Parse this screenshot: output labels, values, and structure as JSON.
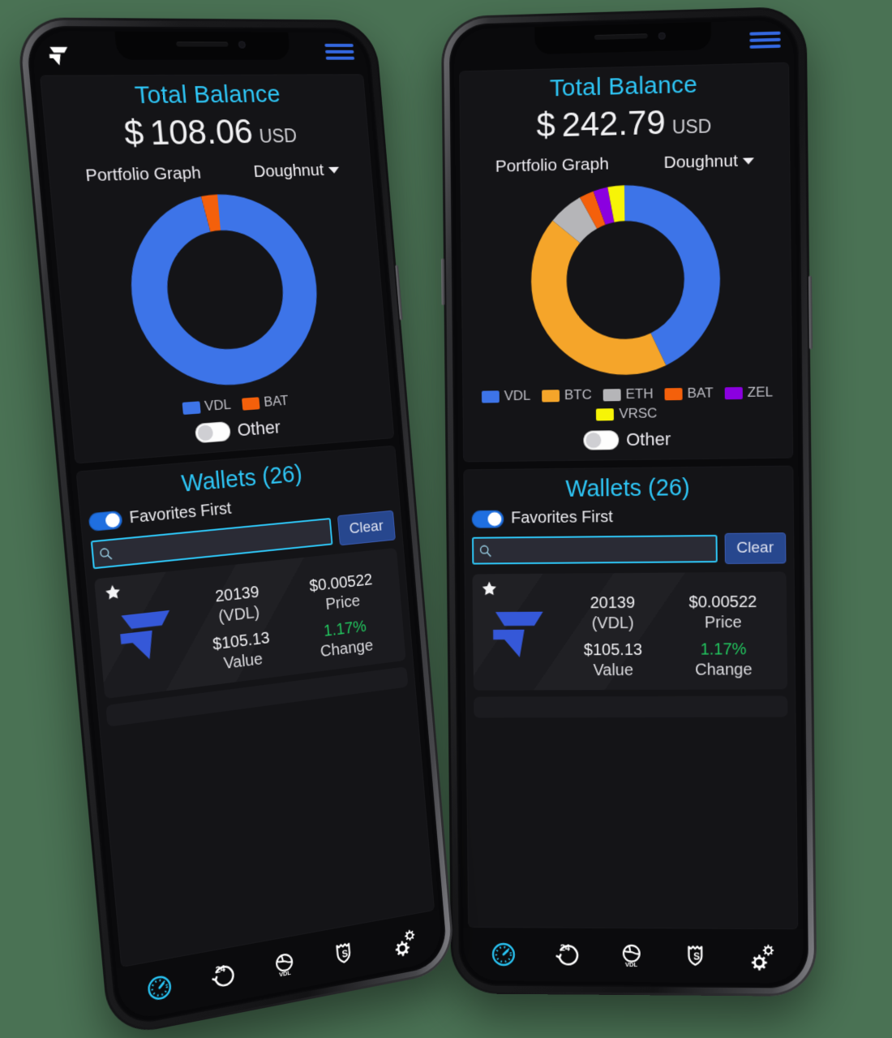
{
  "background_color": "#4a7254",
  "accent": {
    "cyan": "#2ec5f5",
    "blue": "#3468e0",
    "green": "#22c55e",
    "button_blue": "#27478e"
  },
  "phones": [
    {
      "id": "left",
      "brand_logo": "vdl-logo-icon",
      "menu_icon": "hamburger-menu-icon",
      "balance": {
        "title": "Total Balance",
        "currency_symbol": "$",
        "amount": "108.06",
        "currency_code": "USD"
      },
      "graph_controls": {
        "label": "Portfolio Graph",
        "chart_type": "Doughnut",
        "caret_icon": "chevron-down-icon"
      },
      "legend": [
        {
          "label": "VDL",
          "color": "#3d74e8"
        },
        {
          "label": "BAT",
          "color": "#f4600b"
        }
      ],
      "other_toggle": {
        "label": "Other",
        "on": false
      },
      "wallets": {
        "title": "Wallets (26)",
        "favorites_toggle": {
          "label": "Favorites First",
          "on": true
        },
        "search": {
          "value": "",
          "placeholder": "",
          "icon": "search-icon"
        },
        "clear_label": "Clear",
        "items": [
          {
            "favorite": true,
            "coin_logo": "vdl-coin-icon",
            "amount": "20139",
            "ticker": "(VDL)",
            "value": "$105.13",
            "value_label": "Value",
            "price": "$0.00522",
            "price_label": "Price",
            "change": "1.17%",
            "change_label": "Change"
          }
        ]
      },
      "nav": [
        {
          "icon": "dashboard-gauge-icon",
          "active": true
        },
        {
          "icon": "24h-history-icon",
          "active": false
        },
        {
          "icon": "globe-vdl-icon",
          "active": false
        },
        {
          "icon": "shield-dollar-icon",
          "active": false
        },
        {
          "icon": "settings-gears-icon",
          "active": false
        }
      ]
    },
    {
      "id": "right",
      "menu_icon": "hamburger-menu-icon",
      "balance": {
        "title": "Total Balance",
        "currency_symbol": "$",
        "amount": "242.79",
        "currency_code": "USD"
      },
      "graph_controls": {
        "label": "Portfolio Graph",
        "chart_type": "Doughnut",
        "caret_icon": "chevron-down-icon"
      },
      "legend": [
        {
          "label": "VDL",
          "color": "#3d74e8"
        },
        {
          "label": "BTC",
          "color": "#f5a52a"
        },
        {
          "label": "ETH",
          "color": "#b5b5b8"
        },
        {
          "label": "BAT",
          "color": "#f4600b"
        },
        {
          "label": "ZEL",
          "color": "#8b00e0"
        },
        {
          "label": "VRSC",
          "color": "#f7f407"
        }
      ],
      "other_toggle": {
        "label": "Other",
        "on": false
      },
      "wallets": {
        "title": "Wallets (26)",
        "favorites_toggle": {
          "label": "Favorites First",
          "on": true
        },
        "search": {
          "value": "",
          "placeholder": "",
          "icon": "search-icon"
        },
        "clear_label": "Clear",
        "items": [
          {
            "favorite": true,
            "coin_logo": "vdl-coin-icon",
            "amount": "20139",
            "ticker": "(VDL)",
            "value": "$105.13",
            "value_label": "Value",
            "price": "$0.00522",
            "price_label": "Price",
            "change": "1.17%",
            "change_label": "Change"
          }
        ]
      },
      "nav": [
        {
          "icon": "dashboard-gauge-icon",
          "active": true
        },
        {
          "icon": "24h-history-icon",
          "active": false
        },
        {
          "icon": "globe-vdl-icon",
          "active": false
        },
        {
          "icon": "shield-dollar-icon",
          "active": false
        },
        {
          "icon": "settings-gears-icon",
          "active": false
        }
      ]
    }
  ],
  "chart_data": [
    {
      "type": "pie",
      "title": "Portfolio Graph",
      "subtitle": "Doughnut",
      "device": "left",
      "categories": [
        "VDL",
        "BAT"
      ],
      "values": [
        97,
        3
      ],
      "colors": [
        "#3d74e8",
        "#f4600b"
      ],
      "legend_position": "bottom",
      "units": "percent of total balance"
    },
    {
      "type": "pie",
      "title": "Portfolio Graph",
      "subtitle": "Doughnut",
      "device": "right",
      "categories": [
        "VDL",
        "BTC",
        "ETH",
        "BAT",
        "ZEL",
        "VRSC"
      ],
      "values": [
        43,
        43,
        6,
        2.5,
        2.5,
        3
      ],
      "colors": [
        "#3d74e8",
        "#f5a52a",
        "#b5b5b8",
        "#f4600b",
        "#8b00e0",
        "#f7f407"
      ],
      "legend_position": "bottom",
      "units": "percent of total balance"
    }
  ]
}
